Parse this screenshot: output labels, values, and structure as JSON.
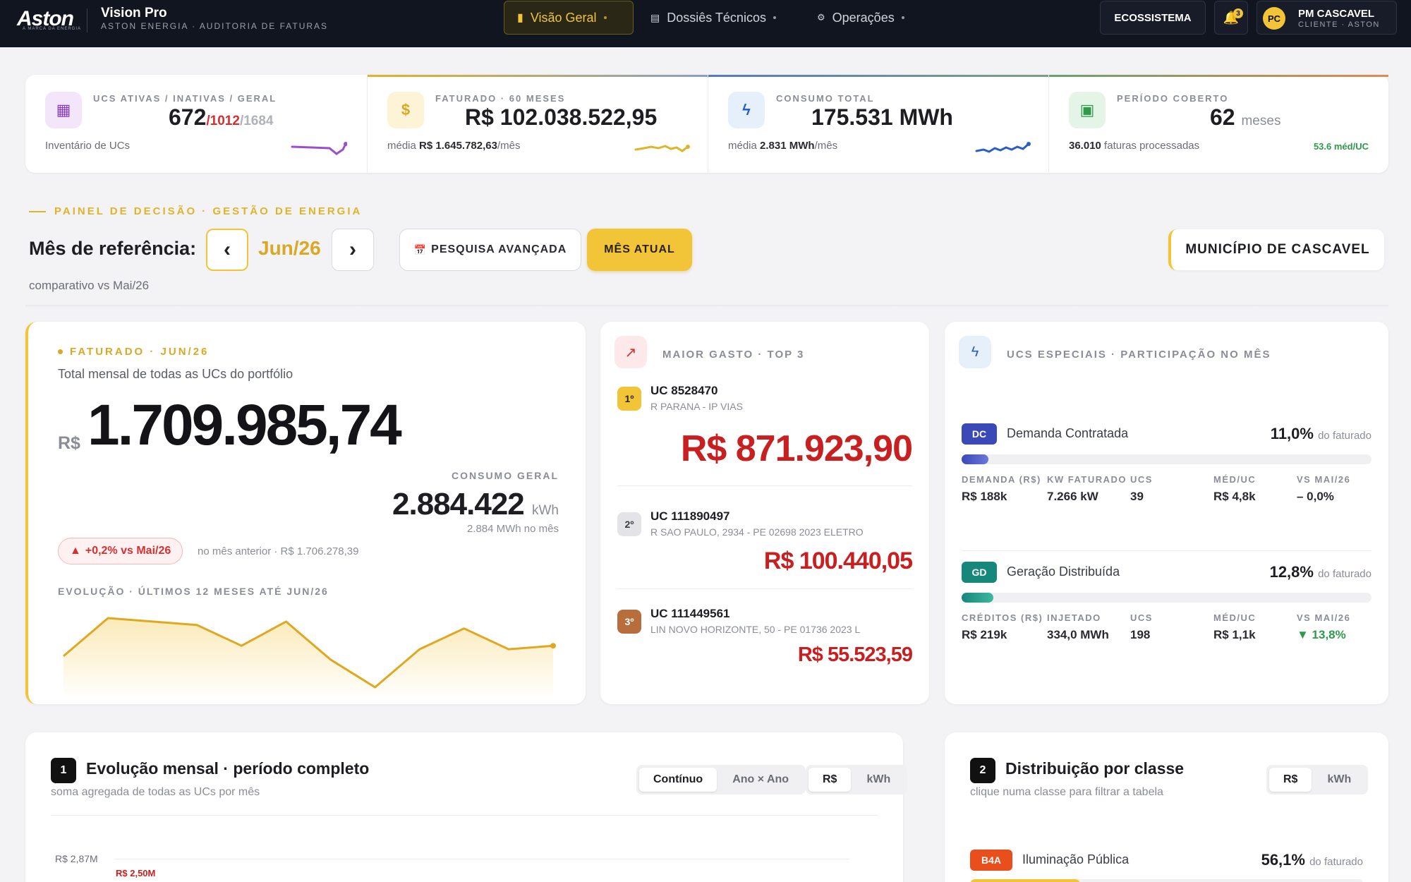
{
  "brand": {
    "logo": "Aston",
    "logo_sub": "A MARCA DA ENERGIA",
    "app_title": "Vision Pro",
    "app_sub": "ASTON ENERGIA · AUDITORIA DE FATURAS"
  },
  "nav": {
    "items": [
      {
        "label": "Visão Geral",
        "icon": "chart-icon",
        "active": true
      },
      {
        "label": "Dossiês Técnicos",
        "icon": "document-icon",
        "active": false
      },
      {
        "label": "Operações",
        "icon": "gear-icon",
        "active": false
      }
    ],
    "ecosystem_label": "ECOSSISTEMA",
    "notifications_count": "3",
    "user": {
      "initials": "PC",
      "name": "PM CASCAVEL",
      "role": "CLIENTE · ASTON"
    }
  },
  "kpis": [
    {
      "label": "UCS ATIVAS / INATIVAS / GERAL",
      "value_main": "672",
      "value_red": "/1012",
      "value_gray": "/1684",
      "foot": "Inventário de UCs",
      "icon": "table-icon",
      "accent": "#8b3fbf"
    },
    {
      "label": "FATURADO · 60 MESES",
      "value": "R$ 102.038.522,95",
      "foot_pre": "média ",
      "foot_bold": "R$ 1.645.782,63",
      "foot_post": "/mês",
      "icon": "dollar-icon",
      "accent": "#e0b42a"
    },
    {
      "label": "CONSUMO TOTAL",
      "value": "175.531 MWh",
      "foot_pre": "média ",
      "foot_bold": "2.831 MWh",
      "foot_post": "/mês",
      "icon": "bolt-icon",
      "accent": "#2a5fc8"
    },
    {
      "label": "PERÍODO COBERTO",
      "value": "62",
      "unit": "meses",
      "foot_bold": "36.010",
      "foot_post": " faturas processadas",
      "right_note": "53.6 méd/UC",
      "icon": "calendar-icon",
      "accent": "#2f9a4a"
    }
  ],
  "decision": {
    "eyebrow": "PAINEL DE DECISÃO · GESTÃO DE ENERGIA",
    "ref_label": "Mês de referência:",
    "month": "Jun/26",
    "prev_icon": "‹",
    "next_icon": "›",
    "search_label": "PESQUISA AVANÇADA",
    "current_label": "MÊS ATUAL",
    "comparativo": "comparativo vs Mai/26",
    "municipio": "MUNICÍPIO DE CASCAVEL"
  },
  "faturado": {
    "tag": "FATURADO ·  JUN/26",
    "desc": "Total mensal de todas as UCs do portfólio",
    "currency": "R$",
    "total": "1.709.985,74",
    "consumo_label": "CONSUMO GERAL",
    "consumo_value": "2.884.422",
    "consumo_unit": "kWh",
    "consumo_sub": "2.884 MWh no mês",
    "delta": "+0,2% vs Mai/26",
    "prev": "no mês anterior · R$ 1.706.278,39",
    "evo_label": "EVOLUÇÃO · ÚLTIMOS 12 MESES ATÉ JUN/26",
    "evo_values": [
      1.68,
      1.79,
      1.78,
      1.77,
      1.71,
      1.78,
      1.67,
      1.59,
      1.7,
      1.76,
      1.7,
      1.71
    ]
  },
  "top3": {
    "title": "MAIOR GASTO · TOP 3",
    "items": [
      {
        "rank": "1º",
        "uc": "UC 8528470",
        "addr": "R PARANA - IP VIAS",
        "value": "R$ 871.923,90"
      },
      {
        "rank": "2º",
        "uc": "UC 111890497",
        "addr": "R SAO PAULO, 2934 - PE 02698 2023 ELETRO",
        "value": "R$ 100.440,05"
      },
      {
        "rank": "3º",
        "uc": "UC 111449561",
        "addr": "LIN NOVO HORIZONTE, 50 - PE 01736 2023 L",
        "value": "R$ 55.523,59"
      }
    ]
  },
  "especiais": {
    "title": "UCS ESPECIAIS · PARTICIPAÇÃO NO MÊS",
    "suffix": "do faturado",
    "segments": [
      {
        "badge": "DC",
        "name": "Demanda Contratada",
        "pct": "11,0%",
        "fill": 0.11,
        "color": "#3b48b8",
        "cols": [
          {
            "label": "DEMANDA (R$)",
            "value": "R$ 188k"
          },
          {
            "label": "KW FATURADO",
            "value": "7.266 kW"
          },
          {
            "label": "UCS",
            "value": "39"
          },
          {
            "label": "MÉD/UC",
            "value": "R$ 4,8k"
          },
          {
            "label": "VS MAI/26",
            "value": "– 0,0%"
          }
        ]
      },
      {
        "badge": "GD",
        "name": "Geração Distribuída",
        "pct": "12,8%",
        "fill": 0.128,
        "color": "#16877a",
        "cols": [
          {
            "label": "CRÉDITOS (R$)",
            "value": "R$ 219k"
          },
          {
            "label": "INJETADO",
            "value": "334,0 MWh"
          },
          {
            "label": "UCS",
            "value": "198"
          },
          {
            "label": "MÉD/UC",
            "value": "R$ 1,1k"
          },
          {
            "label": "VS MAI/26",
            "value": "▼ 13,8%"
          }
        ]
      }
    ]
  },
  "evolucao": {
    "num": "1",
    "title": "Evolução mensal · período completo",
    "sub": "soma agregada de todas as UCs por mês",
    "modes": [
      "Contínuo",
      "Ano × Ano"
    ],
    "units": [
      "R$",
      "kWh"
    ],
    "y_top": "R$ 2,87M",
    "peak": "R$ 2,50M"
  },
  "distribuicao": {
    "num": "2",
    "title": "Distribuição por classe",
    "sub": "clique numa classe para filtrar a tabela",
    "units": [
      "R$",
      "kWh"
    ],
    "class_badge": "B4A",
    "class_name": "Iluminação Pública",
    "class_pct": "56,1%",
    "class_fill": 0.561,
    "suffix": "do faturado"
  }
}
